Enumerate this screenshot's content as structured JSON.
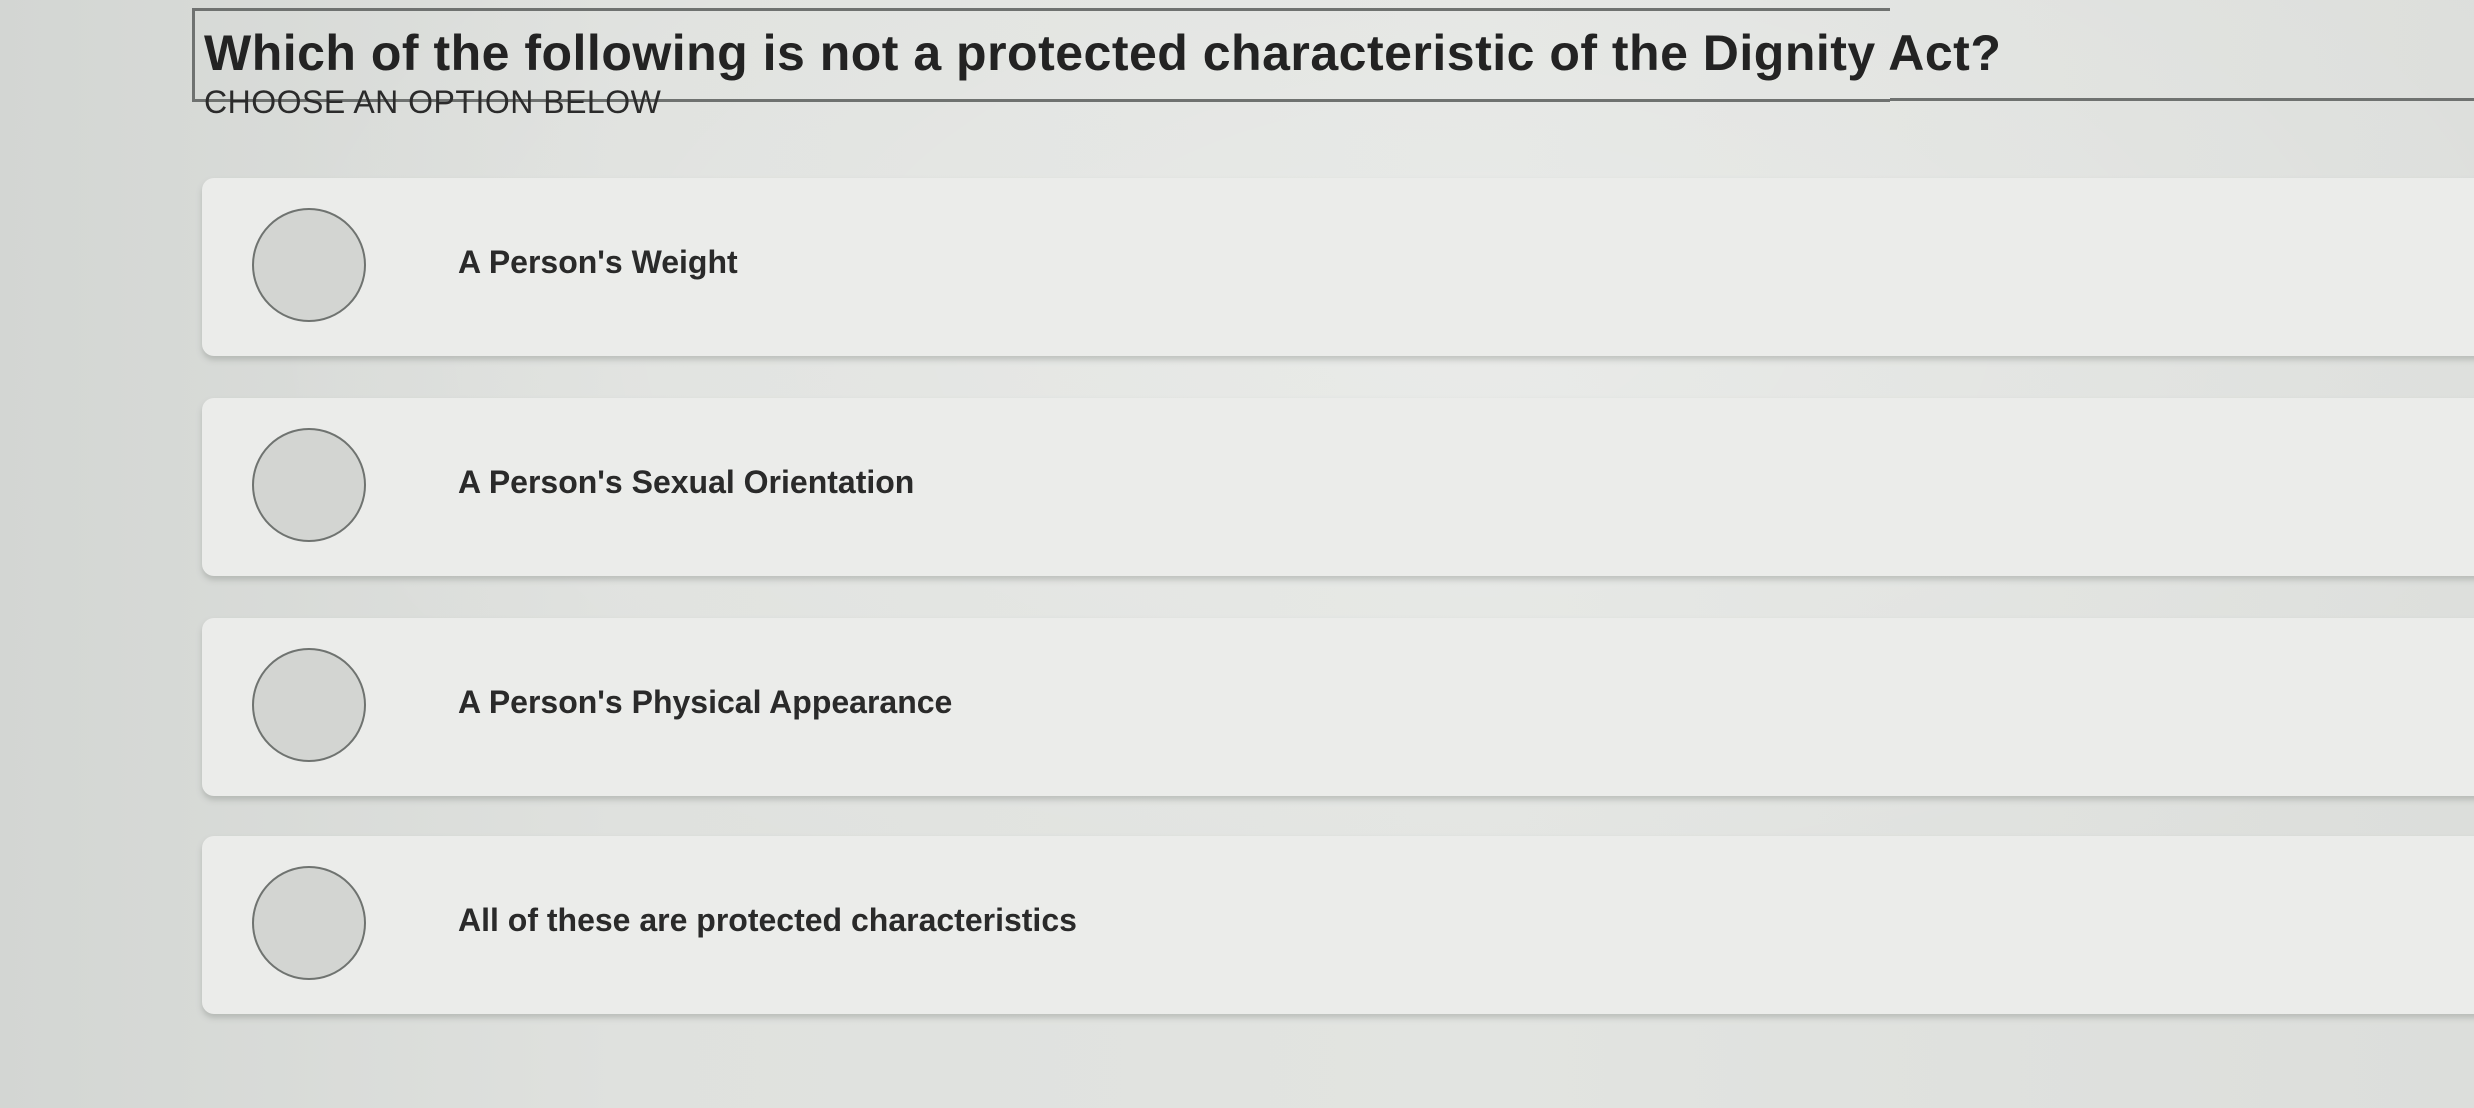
{
  "question": {
    "text": "Which of the following is not a protected characteristic of the Dignity Act?",
    "instruction": "CHOOSE AN OPTION BELOW"
  },
  "options": [
    {
      "label": "A Person's Weight",
      "selected": false
    },
    {
      "label": "A Person's Sexual Orientation",
      "selected": false
    },
    {
      "label": "A Person's Physical Appearance",
      "selected": false
    },
    {
      "label": "All of these are protected characteristics",
      "selected": false
    }
  ]
}
